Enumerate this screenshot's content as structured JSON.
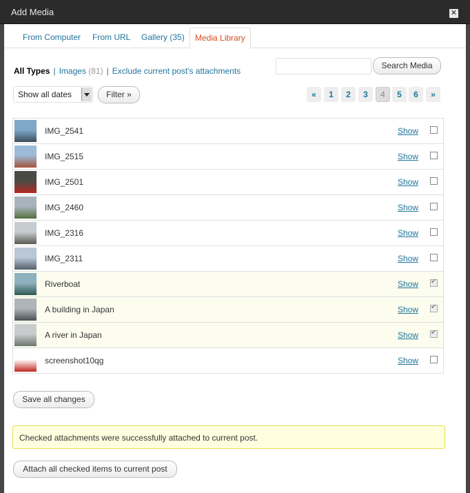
{
  "window": {
    "title": "Add Media"
  },
  "tabs": [
    {
      "label": "From Computer"
    },
    {
      "label": "From URL"
    },
    {
      "label": "Gallery (35)"
    },
    {
      "label": "Media Library"
    }
  ],
  "filters": {
    "all_types": "All Types",
    "images": "Images",
    "images_count": "(81)",
    "exclude": "Exclude current post's attachments",
    "separator": "|"
  },
  "search": {
    "value": "",
    "button": "Search Media"
  },
  "date_select": {
    "selected": "Show all dates"
  },
  "filter_button": "Filter »",
  "pagination": [
    "«",
    "1",
    "2",
    "3",
    "4",
    "5",
    "6",
    "»"
  ],
  "pagination_current": "4",
  "items": [
    {
      "name": "IMG_2541",
      "show": "Show",
      "checked": false,
      "thumb_colors": [
        "#7ea7c8",
        "#3f4d5a"
      ]
    },
    {
      "name": "IMG_2515",
      "show": "Show",
      "checked": false,
      "thumb_colors": [
        "#9dbbd8",
        "#a4523b"
      ]
    },
    {
      "name": "IMG_2501",
      "show": "Show",
      "checked": false,
      "thumb_colors": [
        "#4a4a44",
        "#b52a24"
      ]
    },
    {
      "name": "IMG_2460",
      "show": "Show",
      "checked": false,
      "thumb_colors": [
        "#a9b3bc",
        "#55703d"
      ]
    },
    {
      "name": "IMG_2316",
      "show": "Show",
      "checked": false,
      "thumb_colors": [
        "#c7ccd1",
        "#5b5b4f"
      ]
    },
    {
      "name": "IMG_2311",
      "show": "Show",
      "checked": false,
      "thumb_colors": [
        "#b9c7d6",
        "#54606a"
      ]
    },
    {
      "name": "Riverboat",
      "show": "Show",
      "checked": true,
      "thumb_colors": [
        "#8fb0bd",
        "#2f5a54"
      ]
    },
    {
      "name": "A building in Japan",
      "show": "Show",
      "checked": true,
      "thumb_colors": [
        "#aeb5b9",
        "#4a5257"
      ]
    },
    {
      "name": "A river in Japan",
      "show": "Show",
      "checked": true,
      "thumb_colors": [
        "#c9cccc",
        "#6d7670"
      ]
    },
    {
      "name": "screenshot10qg",
      "show": "Show",
      "checked": false,
      "thumb_colors": [
        "#ffffff",
        "#c0281f"
      ]
    }
  ],
  "save_button": "Save all changes",
  "notice": "Checked attachments were successfully attached to current post.",
  "attach_button": "Attach all checked items to current post",
  "colors": {
    "link": "#21759b",
    "active_tab": "#d54e21",
    "checked_row": "#fcfdee",
    "notice_bg": "#ffffe0"
  }
}
